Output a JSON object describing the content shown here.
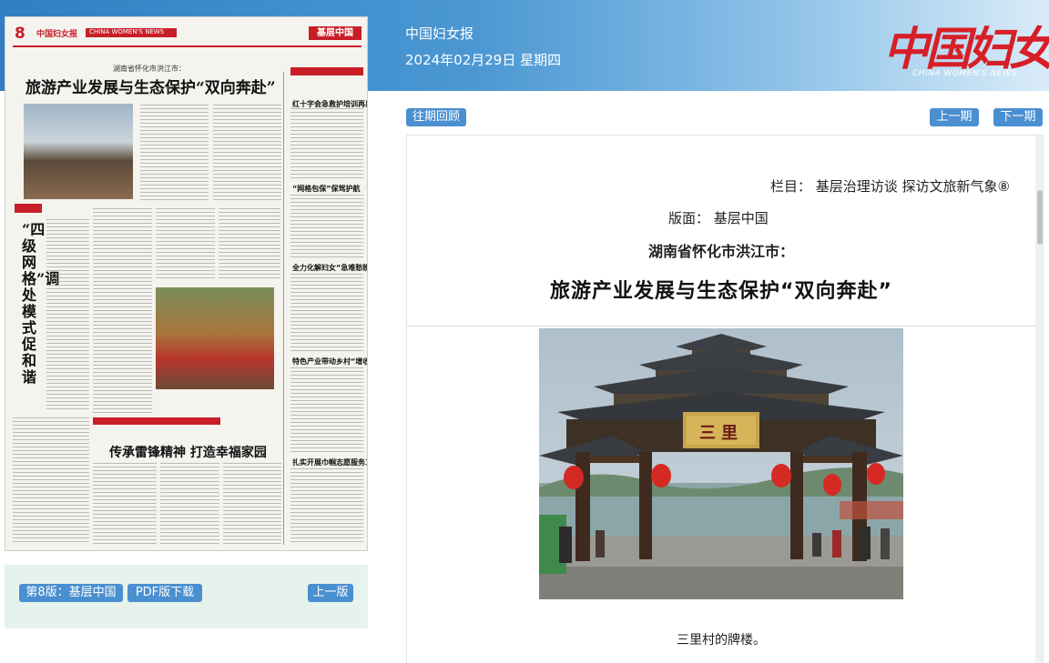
{
  "header": {
    "paper_name": "中国妇女报",
    "date": "2024年02月29日 星期四",
    "logo_text": "中国妇女报",
    "logo_en": "CHINA WOMEN'S NEWS"
  },
  "thumbnail": {
    "page_number": "8",
    "mini_logo": "中国妇女报",
    "mini_en": "CHINA WOMEN'S NEWS",
    "section": "基层中国",
    "kicker": "湖南省怀化市洪江市：",
    "headline": "旅游产业发展与生态保护“双向奔赴”",
    "vertical_title": "“四级网格”调处模式促和谐",
    "headline2": "传承雷锋精神 打造幸福家园",
    "side_heads": [
      "红十字会急救护培训再出新招",
      "“网格包保”保驾护航",
      "全力化解妇女“急难愁盼”",
      "特色产业带动乡村“增收通”",
      "扎实开展巾帼志愿服务工作"
    ]
  },
  "left_buttons": {
    "archive": "往期回顾",
    "page_label": "第8版：基层中国",
    "pdf": "PDF版下载",
    "prev_page": "上一版"
  },
  "article_nav": {
    "prev": "上一期",
    "next": "下一期"
  },
  "article": {
    "column": "栏目：  基层治理访谈 探访文旅新气象⑧",
    "page": "版面：  基层中国",
    "subtitle": "湖南省怀化市洪江市：",
    "title": "旅游产业发展与生态保护“双向奔赴”",
    "gate_sign": "三里",
    "caption": "三里村的牌楼。"
  },
  "colors": {
    "header_blue": "#3a88c9",
    "button_blue": "#4a8fd0",
    "logo_red": "#d71f27",
    "left_bottom_bg": "#e6f3ec"
  }
}
